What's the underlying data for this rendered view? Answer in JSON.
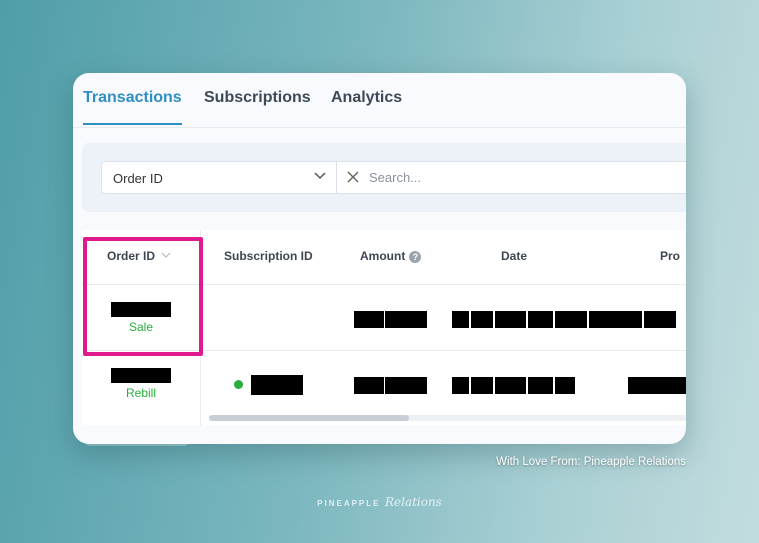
{
  "tabs": [
    {
      "label": "Transactions",
      "active": true
    },
    {
      "label": "Subscriptions",
      "active": false
    },
    {
      "label": "Analytics",
      "active": false
    }
  ],
  "filter": {
    "field_value": "Order ID",
    "search_placeholder": "Search..."
  },
  "table": {
    "columns": [
      "Order ID",
      "Subscription ID",
      "Amount",
      "Date",
      "Pro"
    ],
    "rows": [
      {
        "order_type": "Sale",
        "subscription_status": null
      },
      {
        "order_type": "Rebill",
        "subscription_status": "active"
      }
    ]
  },
  "colors": {
    "accent": "#2f8fc1",
    "status_green": "#27ae3c",
    "highlight": "#e0198c"
  },
  "icons": {
    "select": "chevron-down-icon",
    "clear": "close-icon",
    "info": "info-icon",
    "sort": "sort-down-icon"
  },
  "footer": {
    "credit": "With Love From: Pineapple Relations",
    "logo_text": "PINEAPPLE",
    "logo_script": "Relations"
  }
}
